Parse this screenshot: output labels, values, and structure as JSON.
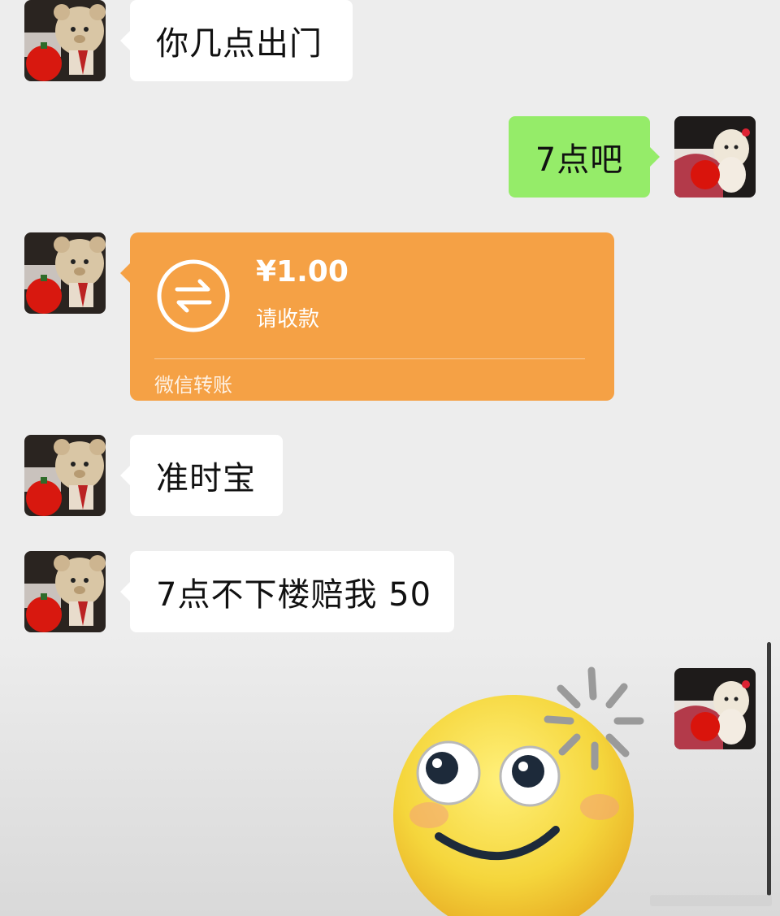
{
  "messages": [
    {
      "side": "left",
      "type": "text",
      "text": "你几点出门"
    },
    {
      "side": "right",
      "type": "text",
      "text": "7点吧"
    },
    {
      "side": "left",
      "type": "transfer",
      "transfer": {
        "amount": "¥1.00",
        "status": "请收款",
        "footer": "微信转账"
      }
    },
    {
      "side": "left",
      "type": "text",
      "text": "准时宝"
    },
    {
      "side": "left",
      "type": "text",
      "text": "7点不下楼赔我 50"
    },
    {
      "side": "right",
      "type": "emoji",
      "emoji_name": "dizzy-smile-emoji-icon"
    }
  ],
  "colors": {
    "background": "#ededed",
    "bubble_incoming": "#ffffff",
    "bubble_outgoing": "#95ec69",
    "transfer_card": "#f5a145"
  },
  "icons": {
    "transfer": "transfer-arrows-icon",
    "avatar_incoming": "teddy-bear-tomato-avatar",
    "avatar_outgoing": "dog-plush-avatar"
  }
}
